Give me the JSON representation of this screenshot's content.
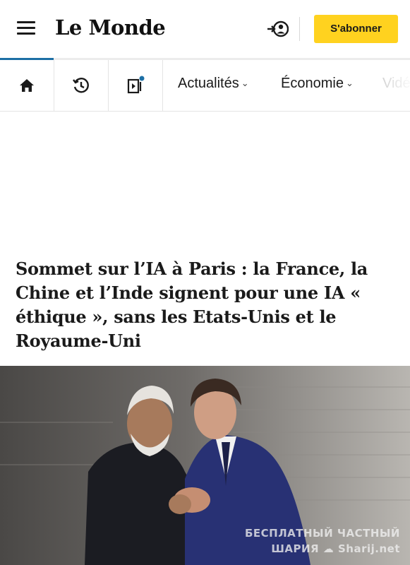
{
  "header": {
    "logo": "Le Monde",
    "subscribe_label": "S'abonner",
    "subscribe_color": "#ffd21f",
    "menu_icon": "hamburger-menu-icon",
    "login_icon": "login-user-icon"
  },
  "nav": {
    "icons": [
      "home-icon",
      "history-icon",
      "video-notification-icon"
    ],
    "links": [
      {
        "label": "Actualités"
      },
      {
        "label": "Économie"
      },
      {
        "label": "Vidé"
      }
    ],
    "accent": "#1d6fa5"
  },
  "article": {
    "headline": "Sommet sur l’IA à Paris : la France, la Chine et l’Inde signent pour une IA « éthique », sans les Etats-Unis et le Royaume-Uni"
  },
  "watermark": {
    "line1": "БЕСПЛАТНЫЙ ЧАСТНЫЙ",
    "line2": "ШАРИЯ ☁ Sharij.net"
  }
}
